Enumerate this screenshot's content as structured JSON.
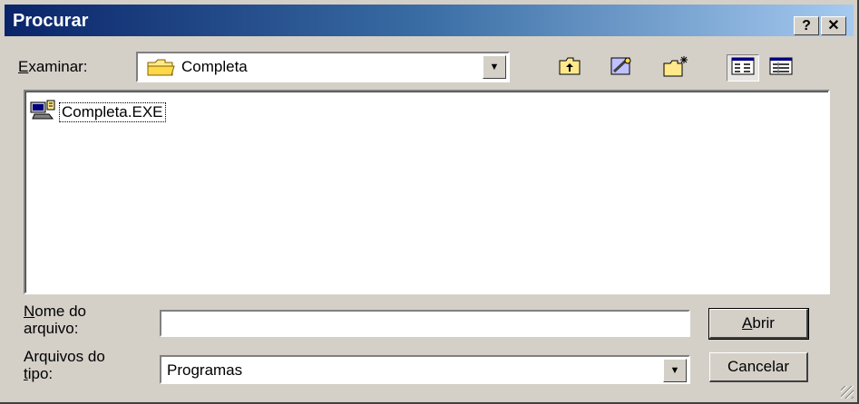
{
  "window": {
    "title": "Procurar",
    "help_glyph": "?",
    "close_glyph": "✕"
  },
  "lookin": {
    "label_accel": "E",
    "label_rest": "xaminar:",
    "value": "Completa",
    "icon": "folder-icon"
  },
  "toolbar": {
    "buttons": [
      {
        "name": "up-one-level-icon"
      },
      {
        "name": "desktop-icon"
      },
      {
        "name": "new-folder-icon"
      },
      {
        "name": "list-view-icon",
        "pressed": true
      },
      {
        "name": "details-view-icon"
      }
    ]
  },
  "files": [
    {
      "name": "Completa.EXE",
      "icon": "executable-icon"
    }
  ],
  "filename": {
    "label_accel": "N",
    "label_line1_rest": "ome do",
    "label_line2": "arquivo:",
    "value": ""
  },
  "filetype": {
    "label_line1": "Arquivos do",
    "label_accel": "t",
    "label_line2_rest": "ipo:",
    "value": "Programas"
  },
  "buttons": {
    "open_accel": "A",
    "open_rest": "brir",
    "cancel": "Cancelar"
  },
  "colors": {
    "title_start": "#0a246a",
    "title_end": "#a6caf0",
    "face": "#d4d0c8"
  }
}
